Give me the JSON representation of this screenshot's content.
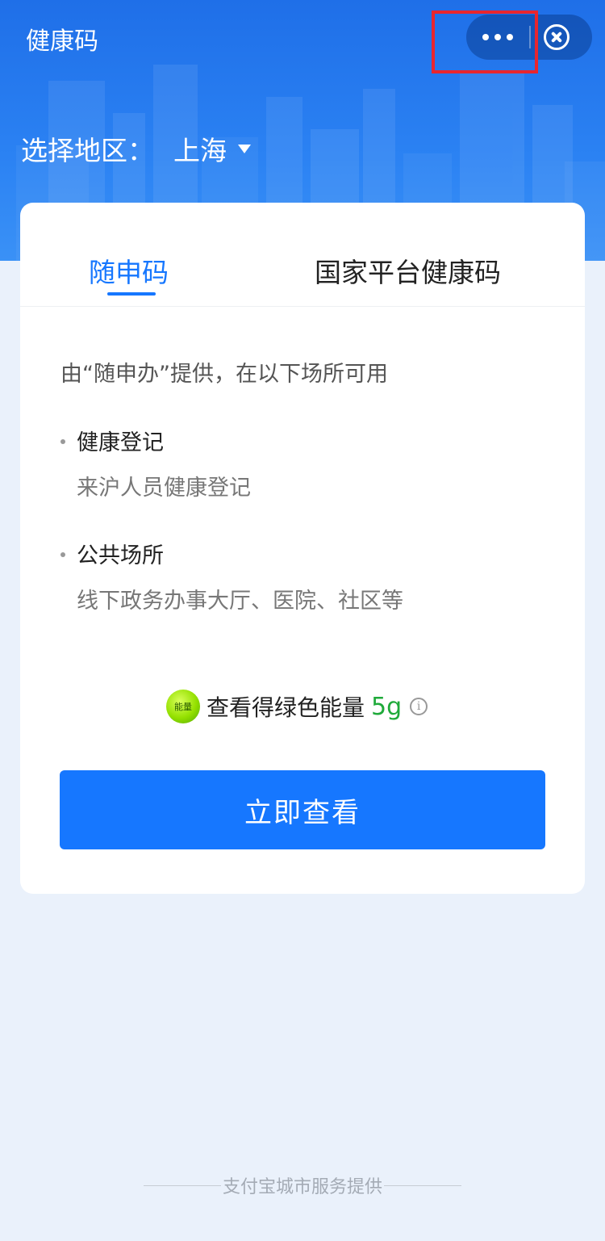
{
  "header": {
    "title": "健康码",
    "more_icon": "more-dots-icon",
    "close_icon": "close-circle-icon",
    "highlight_color": "#e8262e"
  },
  "region": {
    "label": "选择地区：",
    "value": "上海"
  },
  "tabs": [
    {
      "label": "随申码",
      "active": true
    },
    {
      "label": "国家平台健康码",
      "active": false
    }
  ],
  "content": {
    "provider": "由“随申办”提供，在以下场所可用",
    "items": [
      {
        "title": "健康登记",
        "subtitle": "来沪人员健康登记"
      },
      {
        "title": "公共场所",
        "subtitle": "线下政务办事大厅、医院、社区等"
      }
    ]
  },
  "energy": {
    "badge": "能量",
    "text": "查看得绿色能量",
    "amount": "5g",
    "info": "i"
  },
  "action": {
    "button_label": "立即查看"
  },
  "footer": {
    "text": "支付宝城市服务提供"
  },
  "colors": {
    "primary": "#1677ff",
    "energy_green": "#1faa3a",
    "page_background": "#eaf1fb"
  }
}
